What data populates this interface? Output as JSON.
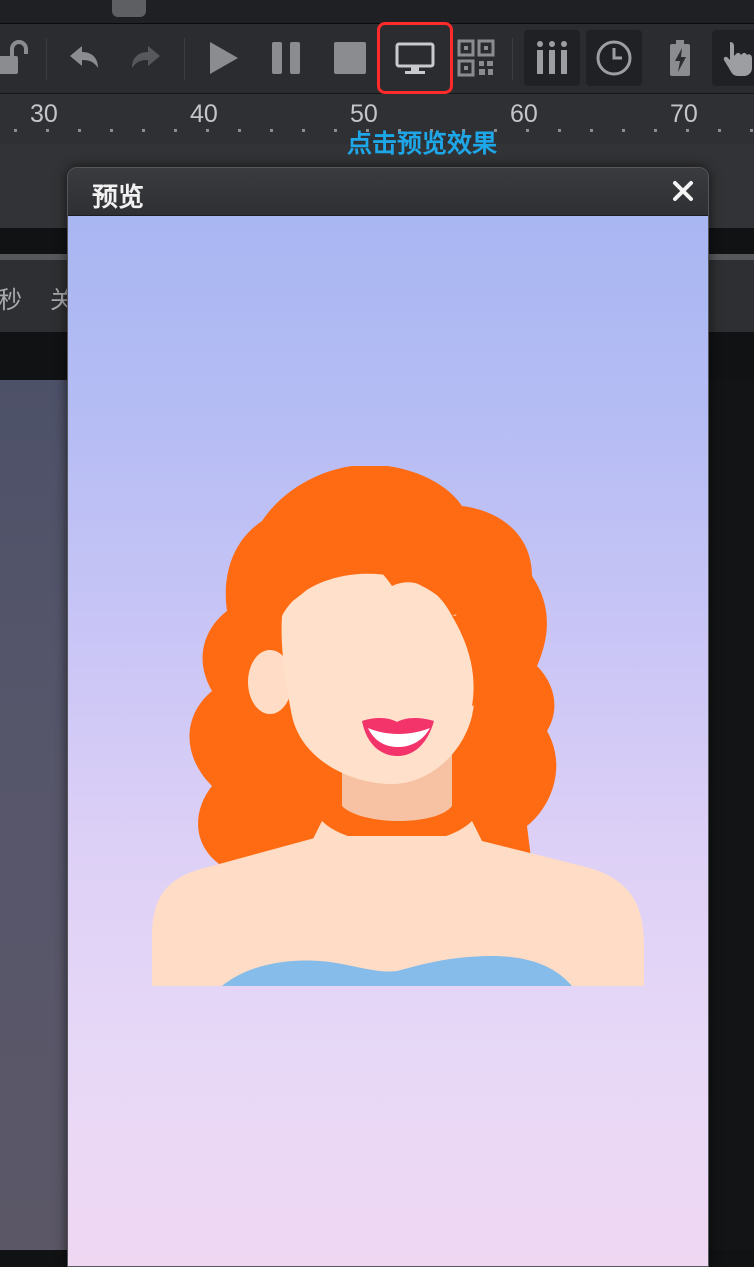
{
  "toolbar": {
    "buttons": [
      {
        "name": "unlock",
        "icon": "unlock-icon"
      },
      {
        "name": "undo",
        "icon": "undo-icon"
      },
      {
        "name": "redo",
        "icon": "redo-icon"
      },
      {
        "name": "play",
        "icon": "play-icon"
      },
      {
        "name": "pause",
        "icon": "pause-icon"
      },
      {
        "name": "stop",
        "icon": "stop-icon"
      },
      {
        "name": "preview",
        "icon": "monitor-icon"
      },
      {
        "name": "qrcode",
        "icon": "qrcode-icon"
      },
      {
        "name": "bars",
        "icon": "bars-icon"
      },
      {
        "name": "timer",
        "icon": "clock-icon"
      },
      {
        "name": "battery",
        "icon": "battery-icon"
      },
      {
        "name": "touch",
        "icon": "hand-icon"
      }
    ],
    "highlight_color": "#ff2a2a"
  },
  "ruler": {
    "labels": [
      "30",
      "40",
      "50",
      "60",
      "70"
    ]
  },
  "tooltip": {
    "text": "点击预览效果",
    "color": "#1ea7e8"
  },
  "panel": {
    "row_text_1": "秒",
    "row_text_2": "关"
  },
  "dialog": {
    "title": "预览",
    "close_symbol": "✕"
  }
}
